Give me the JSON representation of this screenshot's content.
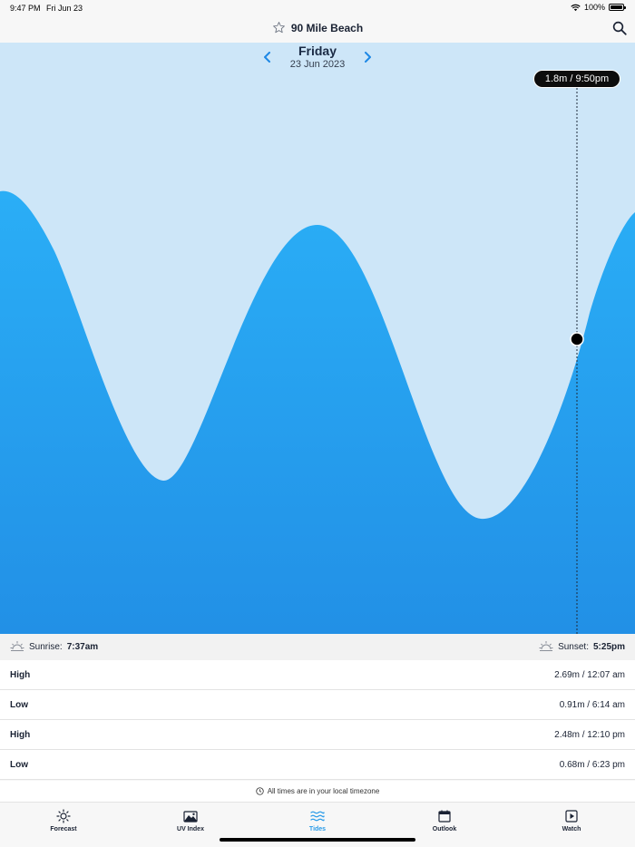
{
  "status_bar": {
    "time": "9:47 PM",
    "date": "Fri Jun 23",
    "battery": "100%"
  },
  "header": {
    "title": "90 Mile Beach"
  },
  "day_nav": {
    "day": "Friday",
    "date": "23 Jun 2023"
  },
  "tooltip": "1.8m / 9:50pm",
  "sun": {
    "sunrise_label": "Sunrise:",
    "sunrise_time": "7:37am",
    "sunset_label": "Sunset:",
    "sunset_time": "5:25pm"
  },
  "tides": [
    {
      "type": "High",
      "value": "2.69m / 12:07 am"
    },
    {
      "type": "Low",
      "value": "0.91m / 6:14 am"
    },
    {
      "type": "High",
      "value": "2.48m / 12:10 pm"
    },
    {
      "type": "Low",
      "value": "0.68m / 6:23 pm"
    }
  ],
  "timezone_note": "All times are in your local timezone",
  "tabs": [
    {
      "label": "Forecast",
      "icon": "sun-icon"
    },
    {
      "label": "UV Index",
      "icon": "uv-mountain-icon"
    },
    {
      "label": "Tides",
      "icon": "waves-icon"
    },
    {
      "label": "Outlook",
      "icon": "calendar-icon"
    },
    {
      "label": "Watch",
      "icon": "play-icon"
    }
  ],
  "colors": {
    "sky": "#cde6f8",
    "water_top": "#2aaef6",
    "water_bottom": "#2290e6",
    "accent": "#2a9be8"
  },
  "tide_curve": {
    "extremes": [
      {
        "time": "12:07 am",
        "height_m": 2.69
      },
      {
        "time": "6:14 am",
        "height_m": 0.91
      },
      {
        "time": "12:10 pm",
        "height_m": 2.48
      },
      {
        "time": "6:23 pm",
        "height_m": 0.68
      }
    ],
    "current": {
      "time": "9:50pm",
      "height_m": 1.8
    }
  }
}
